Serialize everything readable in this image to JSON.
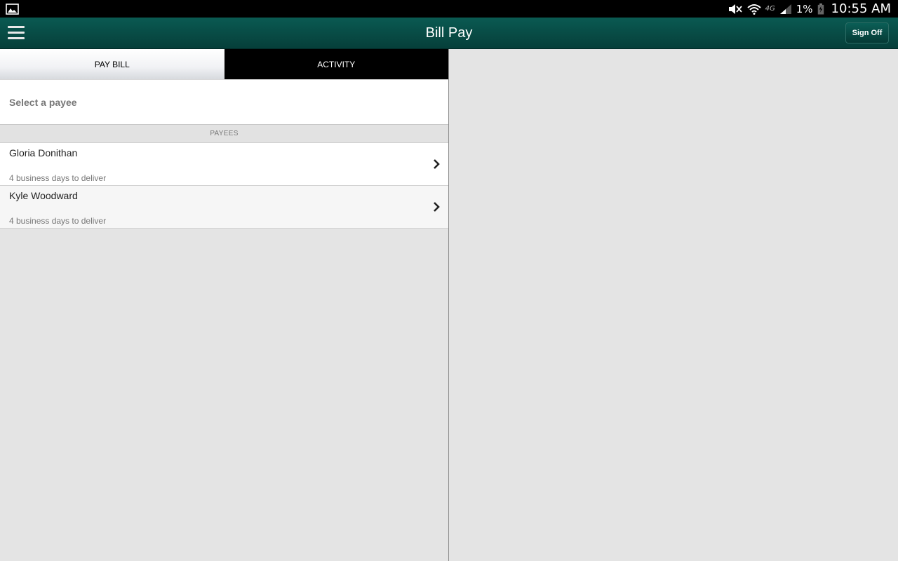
{
  "status_bar": {
    "network_label": "4G",
    "battery_percent": "1%",
    "time": "10:55 AM",
    "icons": [
      "gallery-icon",
      "mute-icon",
      "wifi-icon",
      "signal-icon",
      "battery-icon"
    ]
  },
  "app_bar": {
    "title": "Bill Pay",
    "sign_off_label": "Sign Off",
    "color": "#063f3a"
  },
  "tabs": [
    {
      "label": "PAY BILL",
      "active": true
    },
    {
      "label": "ACTIVITY",
      "active": false
    }
  ],
  "select_payee": "Select a payee",
  "payees_header": "PAYEES",
  "payees": [
    {
      "name": "Gloria Donithan",
      "delivery": "4 business days to deliver"
    },
    {
      "name": "Kyle Woodward",
      "delivery": "4 business days to deliver"
    }
  ]
}
